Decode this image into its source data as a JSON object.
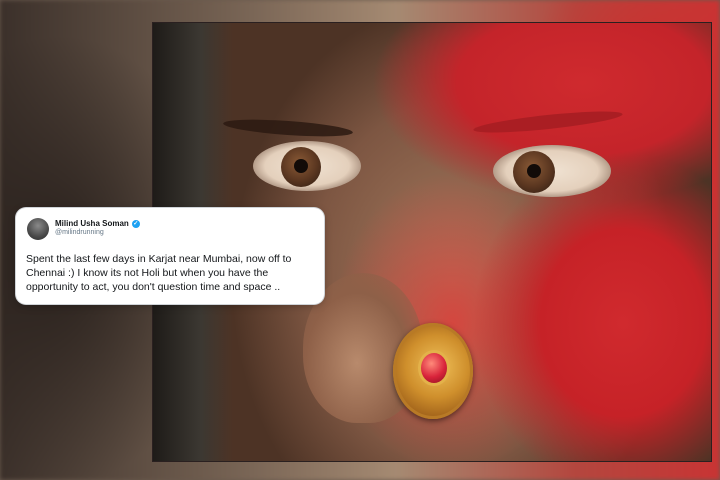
{
  "tweet": {
    "author_name": "Milind Usha Soman",
    "author_handle": "@milindrunning",
    "verified": true,
    "text": "Spent the last few days in Karjat near Mumbai, now off to Chennai :) I know its not Holi but when you have the opportunity to act, you don't question time and space .."
  },
  "photo": {
    "subject": "close-up face with red gulal powder and gold nose ring"
  },
  "colors": {
    "gulal_red": "#c62227",
    "verified_blue": "#1da1f2",
    "card_bg": "#ffffff"
  }
}
